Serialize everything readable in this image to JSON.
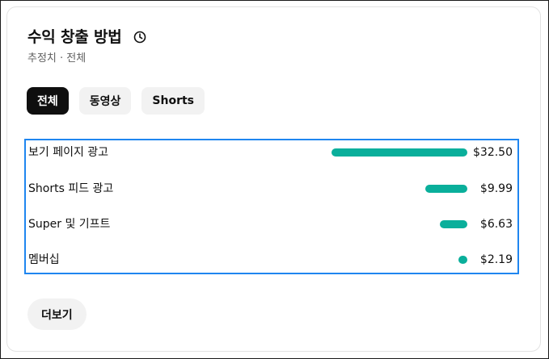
{
  "card": {
    "title": "수익 창출 방법",
    "subtitle": "추정치 · 전체",
    "history_icon": "history-icon"
  },
  "tabs": [
    {
      "label": "전체",
      "active": true
    },
    {
      "label": "동영상",
      "active": false
    },
    {
      "label": "Shorts",
      "active": false
    }
  ],
  "revenue_sources": [
    {
      "label": "보기 페이지 광고",
      "value": "$32.50",
      "amount": 32.5
    },
    {
      "label": "Shorts 피드 광고",
      "value": "$9.99",
      "amount": 9.99
    },
    {
      "label": "Super 및 기프트",
      "value": "$6.63",
      "amount": 6.63
    },
    {
      "label": "멤버십",
      "value": "$2.19",
      "amount": 2.19
    }
  ],
  "more_button": {
    "label": "더보기"
  },
  "colors": {
    "bar": "#0aaf9b",
    "selection_border": "#1f86f0",
    "active_chip": "#0f0f0f"
  }
}
